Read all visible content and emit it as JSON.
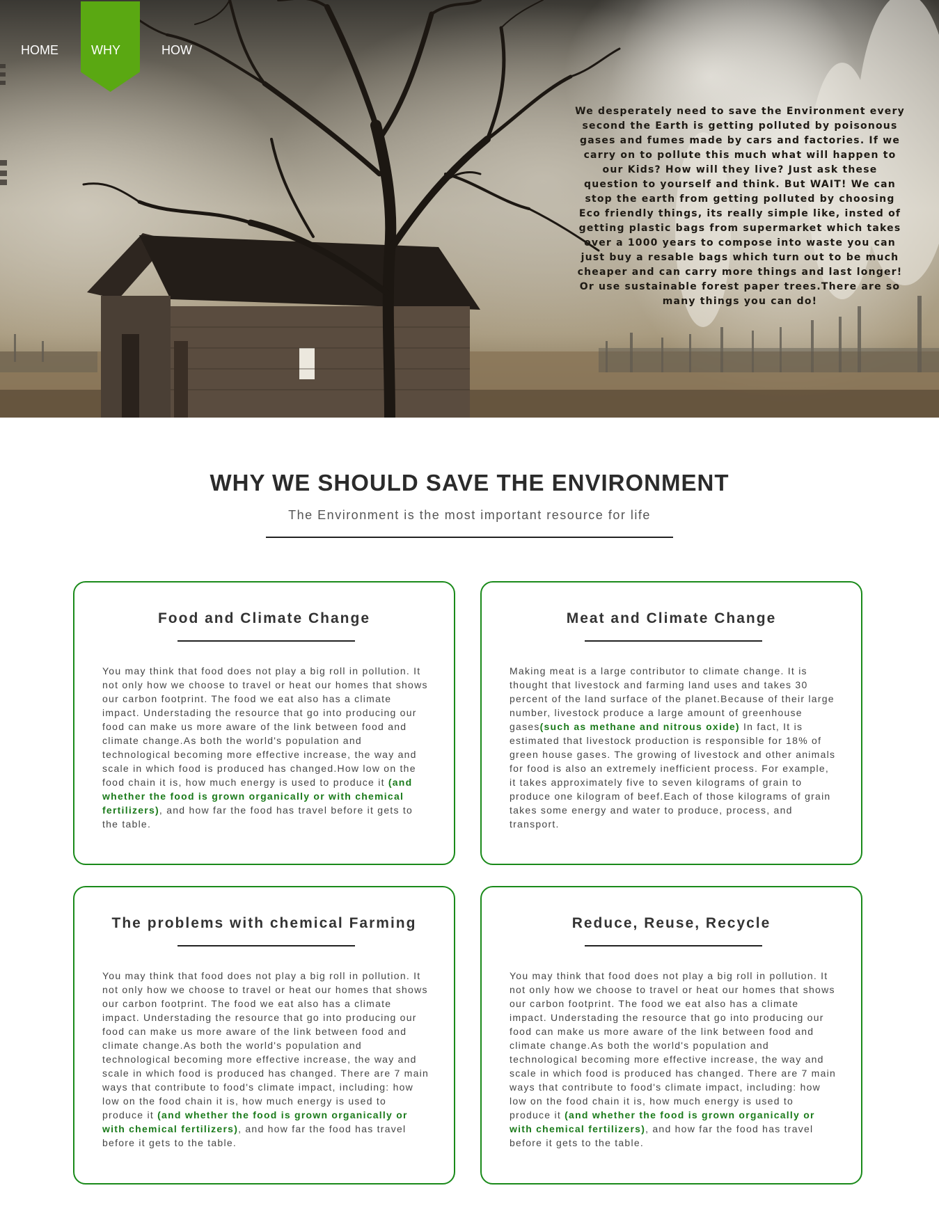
{
  "nav": {
    "items": [
      {
        "label": "HOME"
      },
      {
        "label": "WHY"
      },
      {
        "label": "HOW"
      }
    ],
    "active": "WHY",
    "active_color": "#5aa812"
  },
  "hero": {
    "text": "We desperately need to save the Environment every second the Earth is getting polluted by poisonous gases and fumes made by cars and factories. If we carry on to pollute this much what will happen to our Kids? How will they live? Just ask these question to yourself and think. But WAIT! We can stop the earth from getting polluted by choosing Eco friendly things, its really simple like, insted of getting plastic bags from supermarket which takes over a 1000 years to compose into waste you can just buy a resable bags which turn out to be much cheaper and can carry more things and last longer! Or use sustainable forest paper trees.There are so many things you can do!"
  },
  "section": {
    "title": "WHY WE SHOULD SAVE THE ENVIRONMENT",
    "subtitle": "The Environment is the most important resource for life"
  },
  "colors": {
    "card_border": "#1a8a1a",
    "highlight": "#1a7a1a"
  },
  "cards": [
    {
      "title": "Food and Climate Change",
      "before": "You may think that food does not play a big roll in pollution. It not only how we choose to travel or heat our homes that shows our carbon footprint. The food we eat also has a climate impact. Understading the resource that go into producing our food can make us more aware of the link between food and climate change.As both the world's population and technological becoming more effective increase, the way and scale in which food is produced has changed.How low on the food chain it is, how much energy is used to produce it ",
      "highlight": "(and whether the food is grown organically or with chemical fertilizers)",
      "after": ", and how far the food has travel before it gets to the table."
    },
    {
      "title": "Meat and Climate Change",
      "before": "Making meat is a large contributor to climate change. It is thought that livestock and farming land uses and takes 30 percent of the land surface of the planet.Because of their large number, livestock produce a large amount of greenhouse gases",
      "highlight": "(such as methane and nitrous oxide)",
      "after": " In fact, It is estimated that livestock production is responsible for 18% of green house gases. The growing of livestock and other animals for food is also an extremely inefficient process. For example, it takes approximately five to seven kilograms of grain to produce one kilogram of beef.Each of those kilograms of grain takes some energy and water to produce, process, and transport."
    },
    {
      "title": "The problems with chemical Farming",
      "before": "You may think that food does not play a big roll in pollution. It not only how we choose to travel or heat our homes that shows our carbon footprint. The food we eat also has a climate impact. Understading the resource that go into producing our food can make us more aware of the link between food and climate change.As both the world's population and technological becoming more effective increase, the way and scale in which food is produced has changed. There are 7 main ways that contribute to food's climate impact, including: how low on the food chain it is, how much energy is used to produce it ",
      "highlight": "(and whether the food is grown organically or with chemical fertilizers)",
      "after": ", and how far the food has travel before it gets to the table."
    },
    {
      "title": "Reduce, Reuse, Recycle",
      "before": "You may think that food does not play a big roll in pollution. It not only how we choose to travel or heat our homes that shows our carbon footprint. The food we eat also has a climate impact. Understading the resource that go into producing our food can make us more aware of the link between food and climate change.As both the world's population and technological becoming more effective increase, the way and scale in which food is produced has changed. There are 7 main ways that contribute to food's climate impact, including: how low on the food chain it is, how much energy is used to produce it ",
      "highlight": "(and whether the food is grown organically or with chemical fertilizers)",
      "after": ", and how far the food has travel before it gets to the table."
    }
  ]
}
